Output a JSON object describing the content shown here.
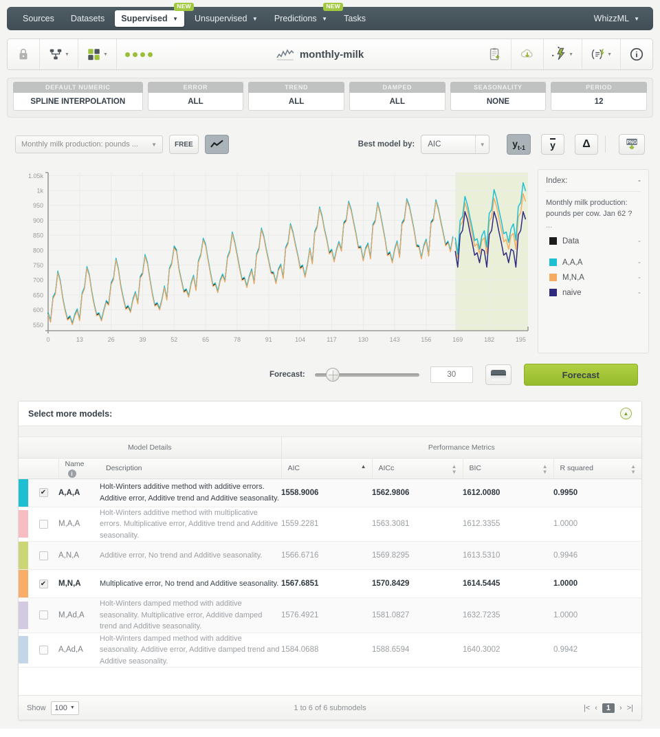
{
  "nav": {
    "items": [
      {
        "label": "Sources",
        "caret": false,
        "badge": null,
        "active": false
      },
      {
        "label": "Datasets",
        "caret": false,
        "badge": null,
        "active": false
      },
      {
        "label": "Supervised",
        "caret": true,
        "badge": "NEW",
        "active": true
      },
      {
        "label": "Unsupervised",
        "caret": true,
        "badge": null,
        "active": false
      },
      {
        "label": "Predictions",
        "caret": true,
        "badge": "NEW",
        "active": false
      },
      {
        "label": "Tasks",
        "caret": false,
        "badge": null,
        "active": false
      }
    ],
    "account": "WhizzML"
  },
  "toolbar": {
    "title": "monthly-milk",
    "icons_left": [
      "lock-icon",
      "share-tree-icon",
      "clone-icon"
    ],
    "icons_right": [
      "clipboard-download-icon",
      "cloud-download-icon",
      "flash-actions-icon",
      "script-actions-icon",
      "info-icon"
    ]
  },
  "config": [
    {
      "header": "DEFAULT NUMERIC",
      "value": "SPLINE INTERPOLATION"
    },
    {
      "header": "ERROR",
      "value": "ALL"
    },
    {
      "header": "TREND",
      "value": "ALL"
    },
    {
      "header": "DAMPED",
      "value": "ALL"
    },
    {
      "header": "SEASONALITY",
      "value": "NONE"
    },
    {
      "header": "PERIOD",
      "value": "12"
    }
  ],
  "chart_toolbar": {
    "field_select": "Monthly milk production: pounds ...",
    "free_label": "FREE",
    "chart_toggle_icon": "line-chart-icon",
    "best_model_label": "Best model by:",
    "best_model_value": "AIC",
    "view_buttons": [
      {
        "name": "lag-view-button",
        "label": "y",
        "sub": "t-1",
        "active": true
      },
      {
        "name": "mean-view-button",
        "label": "y",
        "overbar": true,
        "active": false
      },
      {
        "name": "delta-view-button",
        "label": "Δ",
        "active": false
      }
    ],
    "export_label": "PNG"
  },
  "legend": {
    "index_label": "Index:",
    "index_value": "-",
    "description": "Monthly milk production: pounds per cow. Jan 62 ?",
    "ellipsis": "...",
    "entries": [
      {
        "label": "Data",
        "color": "#1c1c1c",
        "value": "-"
      },
      {
        "label": "A,A,A",
        "color": "#1ebfd3",
        "value": "-"
      },
      {
        "label": "M,N,A",
        "color": "#f6ab63",
        "value": "-"
      },
      {
        "label": "naive",
        "color": "#2e2a7f",
        "value": "-"
      }
    ]
  },
  "forecast": {
    "label": "Forecast:",
    "horizon": "30",
    "slider_position_pct": 12,
    "toggle_icon": "split-view-icon",
    "button_label": "Forecast"
  },
  "models_panel": {
    "title": "Select more models:",
    "collapse_icon": "collapse-up-icon",
    "group_headers": [
      "Model Details",
      "Performance Metrics"
    ],
    "columns": [
      {
        "label": "Name",
        "info": true,
        "sort": "none"
      },
      {
        "label": "Description",
        "sort": null
      },
      {
        "label": "AIC",
        "sort": "asc"
      },
      {
        "label": "AICc",
        "sort": "none"
      },
      {
        "label": "BIC",
        "sort": "none"
      },
      {
        "label": "R squared",
        "sort": "none"
      }
    ],
    "rows": [
      {
        "swatch": "#1ebfd3",
        "checked": true,
        "name": "A,A,A",
        "description": "Holt-Winters additive method with additive errors. Additive error, Additive trend and Additive seasonality.",
        "aic": "1558.9006",
        "aicc": "1562.9806",
        "bic": "1612.0080",
        "r2": "0.9950"
      },
      {
        "swatch": "#f7bdc2",
        "checked": false,
        "name": "M,A,A",
        "description": "Holt-Winters additive method with multiplicative errors. Multiplicative error, Additive trend and Additive seasonality.",
        "aic": "1559.2281",
        "aicc": "1563.3081",
        "bic": "1612.3355",
        "r2": "1.0000"
      },
      {
        "swatch": "#cdd676",
        "checked": false,
        "name": "A,N,A",
        "description": "Additive error, No trend and Additive seasonality.",
        "aic": "1566.6716",
        "aicc": "1569.8295",
        "bic": "1613.5310",
        "r2": "0.9946"
      },
      {
        "swatch": "#f8ad68",
        "checked": true,
        "name": "M,N,A",
        "description": "Multiplicative error, No trend and Additive seasonality.",
        "aic": "1567.6851",
        "aicc": "1570.8429",
        "bic": "1614.5445",
        "r2": "1.0000"
      },
      {
        "swatch": "#d4c9e2",
        "checked": false,
        "name": "M,Ad,A",
        "description": "Holt-Winters damped method with additive seasonality. Multiplicative error, Additive damped trend and Additive seasonality.",
        "aic": "1576.4921",
        "aicc": "1581.0827",
        "bic": "1632.7235",
        "r2": "1.0000"
      },
      {
        "swatch": "#c3d6e8",
        "checked": false,
        "name": "A,Ad,A",
        "description": "Holt-Winters damped method with additive seasonality. Additive error, Additive damped trend and Additive seasonality.",
        "aic": "1584.0688",
        "aicc": "1588.6594",
        "bic": "1640.3002",
        "r2": "0.9942"
      }
    ],
    "footer": {
      "show_label": "Show",
      "show_value": "100",
      "summary": "1 to 6 of 6 submodels",
      "pager": {
        "first": "|<",
        "prev": "‹",
        "current": "1",
        "next": "›",
        "last": ">|"
      }
    }
  },
  "chart_data": {
    "type": "line",
    "title": "",
    "xlabel": "",
    "ylabel": "",
    "xlim": [
      0,
      198
    ],
    "ylim": [
      530,
      1060
    ],
    "xticks": [
      0,
      13,
      26,
      39,
      52,
      65,
      78,
      91,
      104,
      117,
      130,
      143,
      156,
      169,
      182,
      195
    ],
    "yticks": [
      550,
      600,
      650,
      700,
      750,
      800,
      850,
      900,
      950,
      1000,
      1050
    ],
    "yticklabels": [
      "550",
      "600",
      "650",
      "700",
      "750",
      "800",
      "850",
      "900",
      "950",
      "1k",
      "1.05k"
    ],
    "grid": true,
    "legend_position": "right",
    "forecast_band": {
      "start": 168,
      "end": 198,
      "color": "#eaf0d8"
    },
    "series": [
      {
        "name": "Data",
        "color": "#1c1c1c",
        "x_start": 0,
        "values": [
          589,
          561,
          640,
          656,
          727,
          697,
          640,
          599,
          568,
          577,
          553,
          582,
          600,
          566,
          653,
          673,
          742,
          716,
          660,
          617,
          583,
          587,
          565,
          598,
          628,
          618,
          688,
          705,
          770,
          736,
          678,
          639,
          604,
          611,
          594,
          634,
          658,
          622,
          709,
          722,
          782,
          756,
          702,
          653,
          615,
          621,
          602,
          635,
          677,
          635,
          736,
          755,
          811,
          798,
          735,
          697,
          661,
          667,
          645,
          688,
          713,
          667,
          762,
          784,
          837,
          817,
          767,
          722,
          681,
          687,
          660,
          698,
          717,
          696,
          775,
          796,
          858,
          826,
          783,
          740,
          701,
          706,
          677,
          711,
          734,
          690,
          785,
          805,
          871,
          845,
          801,
          764,
          725,
          723,
          690,
          734,
          750,
          707,
          807,
          824,
          886,
          859,
          819,
          783,
          740,
          747,
          711,
          751,
          804,
          756,
          860,
          878,
          942,
          913,
          869,
          834,
          790,
          800,
          763,
          800,
          826,
          799,
          890,
          900,
          961,
          935,
          894,
          855,
          809,
          810,
          766,
          805,
          821,
          773,
          883,
          898,
          957,
          924,
          881,
          837,
          784,
          791,
          760,
          802,
          828,
          778,
          889,
          902,
          969,
          947,
          908,
          867,
          815,
          812,
          773,
          813,
          834,
          782,
          892,
          903,
          966,
          937,
          896,
          858,
          817,
          827,
          797,
          843
        ]
      },
      {
        "name": "A,A,A",
        "color": "#1ebfd3",
        "x_start": 168,
        "values": [
          842,
          787,
          900,
          913,
          980,
          952,
          912,
          875,
          832,
          838,
          803,
          849,
          865,
          810,
          923,
          936,
          1003,
          975,
          935,
          898,
          855,
          861,
          826,
          872,
          888,
          833,
          946,
          959,
          1026,
          998
        ]
      },
      {
        "name": "M,N,A",
        "color": "#f6ab63",
        "x_start": 168,
        "values": [
          826,
          773,
          882,
          896,
          959,
          933,
          892,
          855,
          813,
          821,
          788,
          833,
          841,
          788,
          897,
          911,
          974,
          948,
          907,
          870,
          828,
          836,
          803,
          848,
          856,
          803,
          912,
          926,
          989,
          963
        ]
      },
      {
        "name": "naive",
        "color": "#2e2a7f",
        "x_start": 168,
        "values": [
          797,
          743,
          852,
          866,
          929,
          903,
          862,
          825,
          783,
          791,
          758,
          803,
          797,
          743,
          852,
          866,
          929,
          903,
          862,
          825,
          783,
          791,
          758,
          803,
          797,
          743,
          852,
          866,
          929,
          903
        ]
      }
    ]
  }
}
